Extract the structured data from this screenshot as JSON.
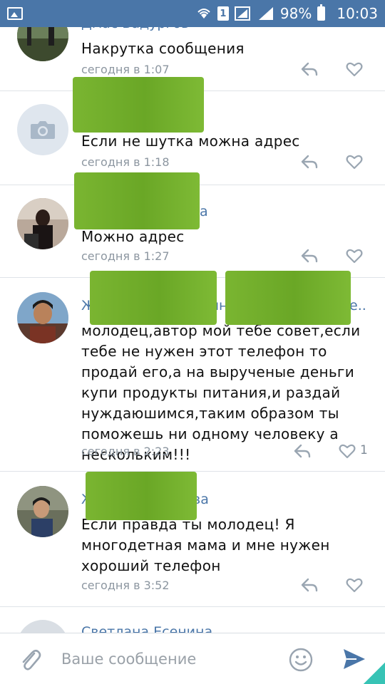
{
  "status_bar": {
    "battery": "98%",
    "time": "10:03",
    "sim": "1"
  },
  "comments": [
    {
      "author": "Дмас Бадургов",
      "text": "Накрутка сообщения",
      "date": "сегодня в 1:07",
      "likes": ""
    },
    {
      "author": "",
      "text": "Если не шутка можна адрес",
      "date": "сегодня в 1:18",
      "likes": ""
    },
    {
      "author": "а",
      "text": "Можно адрес",
      "date": "сегодня в 1:27",
      "likes": ""
    },
    {
      "author": "Ж",
      "author_tail": "ын",
      "author_end": "е..",
      "text": "молодец,автор мой тебе совет,если тебе не нужен этот телефон то продай его,а на вырученые деньги купи  продукты питания,и раздай нуждаюшимся,таким образом ты поможешь ни одному человеку а нескольким!!!",
      "date": "сегодня в 2:23",
      "likes": "1"
    },
    {
      "author": "Ж",
      "author_tail": "ва",
      "text": "Если правда ты молодец!  Я многодетная мама и мне нужен хороший телефон",
      "date": "сегодня в 3:52",
      "likes": ""
    },
    {
      "author": "Светлана Есенина",
      "text": "",
      "date": "",
      "likes": ""
    }
  ],
  "composer": {
    "placeholder": "Ваше сообщение"
  },
  "icons": {
    "reply": "reply-icon",
    "like": "heart-icon",
    "attach": "paperclip-icon",
    "emoji": "smile-icon",
    "send": "send-icon"
  },
  "colors": {
    "status_bar": "#4a76a8",
    "author_link": "#4a76a8",
    "censor": "#74b02d",
    "send_accent": "#4a76a8"
  }
}
